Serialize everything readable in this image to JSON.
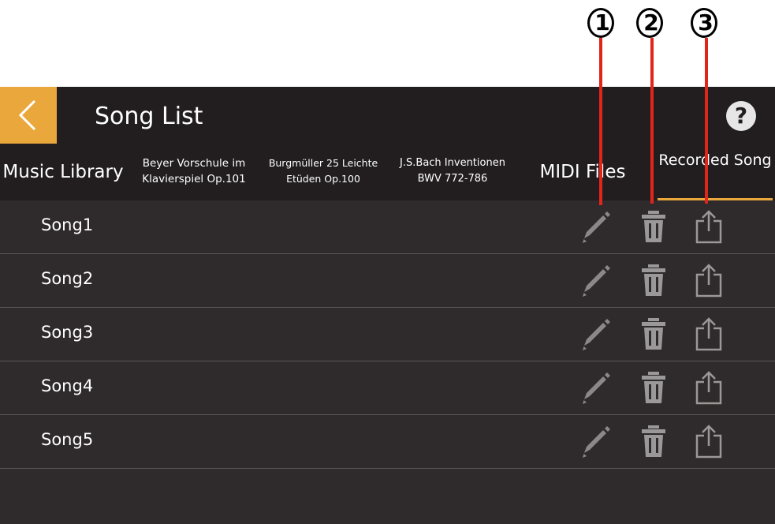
{
  "callouts": [
    "1",
    "2",
    "3"
  ],
  "header": {
    "title": "Song List",
    "help_label": "?"
  },
  "tabs": [
    {
      "label": "Music Library"
    },
    {
      "label": "Beyer Vorschule im Klavierspiel Op.101"
    },
    {
      "label": "Burgmüller 25 Leichte Etüden Op.100"
    },
    {
      "label": "J.S.Bach Inventionen BWV 772-786"
    },
    {
      "label": "MIDI Files"
    },
    {
      "label": "Recorded Song",
      "active": true
    }
  ],
  "songs": [
    "Song1",
    "Song2",
    "Song3",
    "Song4",
    "Song5"
  ],
  "icons": {
    "back": "chevron-left-icon",
    "edit": "pencil-icon",
    "delete": "trash-icon",
    "share": "share-icon"
  },
  "colors": {
    "accent": "#eaa83c",
    "background": "#2f2a2b",
    "header": "#221e1f",
    "callout_line": "#e0251b"
  }
}
